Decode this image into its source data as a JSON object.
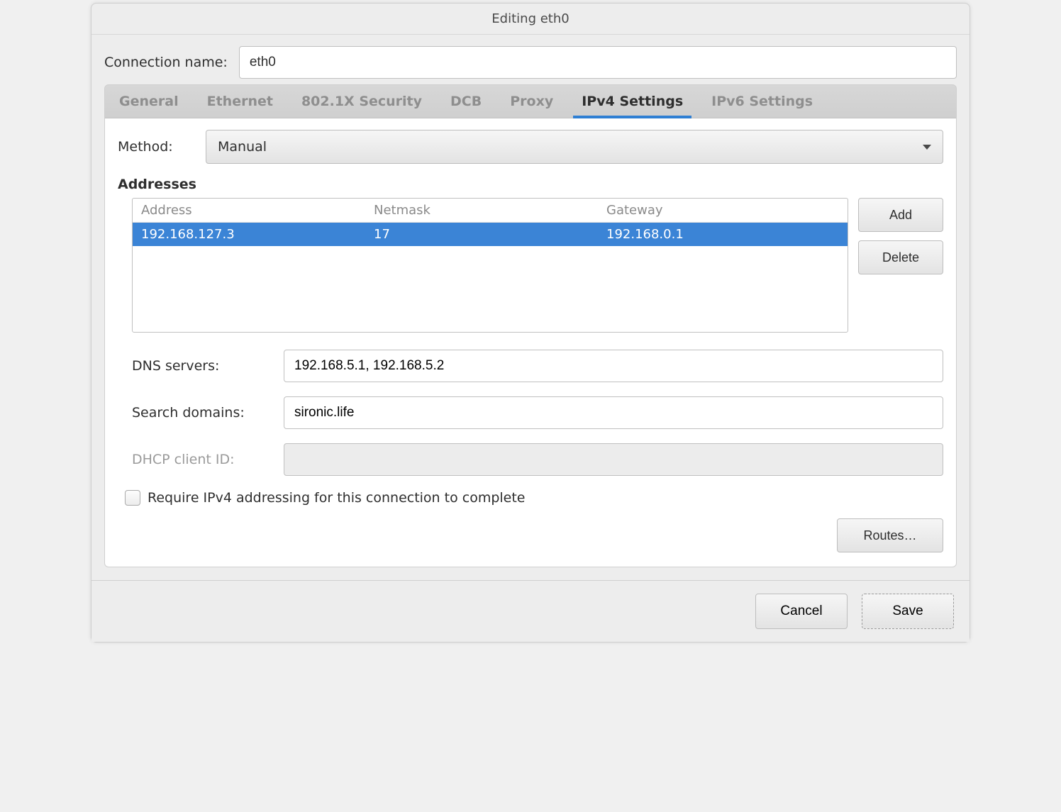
{
  "title": "Editing eth0",
  "connection": {
    "name_label": "Connection name:",
    "name_value": "eth0"
  },
  "tabs": {
    "general": "General",
    "ethernet": "Ethernet",
    "security": "802.1X Security",
    "dcb": "DCB",
    "proxy": "Proxy",
    "ipv4": "IPv4 Settings",
    "ipv6": "IPv6 Settings"
  },
  "ipv4": {
    "method_label": "Method:",
    "method_value": "Manual",
    "addresses_title": "Addresses",
    "columns": {
      "address": "Address",
      "netmask": "Netmask",
      "gateway": "Gateway"
    },
    "rows": [
      {
        "address": "192.168.127.3",
        "netmask": "17",
        "gateway": "192.168.0.1"
      }
    ],
    "buttons": {
      "add": "Add",
      "delete": "Delete"
    },
    "dns_label": "DNS servers:",
    "dns_value": "192.168.5.1, 192.168.5.2",
    "search_label": "Search domains:",
    "search_value": "sironic.life",
    "dhcp_label": "DHCP client ID:",
    "dhcp_value": "",
    "require_label": "Require IPv4 addressing for this connection to complete",
    "routes_label": "Routes…"
  },
  "footer": {
    "cancel": "Cancel",
    "save": "Save"
  }
}
